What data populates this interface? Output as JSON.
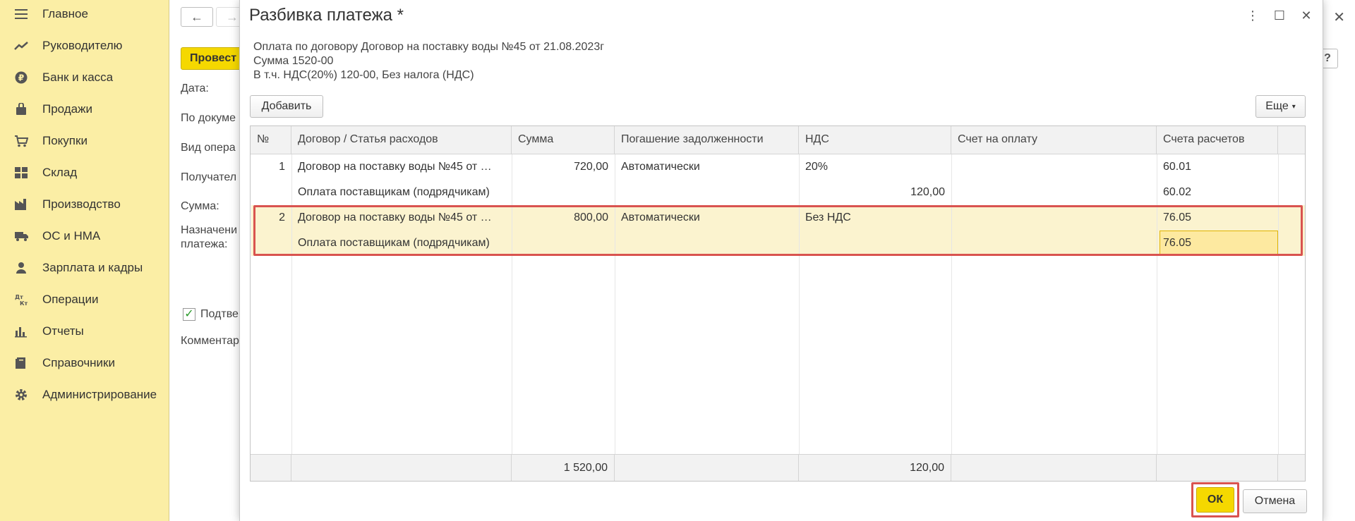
{
  "sidebar": {
    "items": [
      {
        "label": "Главное",
        "icon": "menu-icon"
      },
      {
        "label": "Руководителю",
        "icon": "trend-icon"
      },
      {
        "label": "Банк и касса",
        "icon": "ruble-icon"
      },
      {
        "label": "Продажи",
        "icon": "bag-icon"
      },
      {
        "label": "Покупки",
        "icon": "cart-icon"
      },
      {
        "label": "Склад",
        "icon": "warehouse-icon"
      },
      {
        "label": "Производство",
        "icon": "factory-icon"
      },
      {
        "label": "ОС и НМА",
        "icon": "truck-icon"
      },
      {
        "label": "Зарплата и кадры",
        "icon": "person-icon"
      },
      {
        "label": "Операции",
        "icon": "dtkt-icon"
      },
      {
        "label": "Отчеты",
        "icon": "bar-chart-icon"
      },
      {
        "label": "Справочники",
        "icon": "book-icon"
      },
      {
        "label": "Администрирование",
        "icon": "gear-icon"
      }
    ]
  },
  "background_form": {
    "post_label": "Провест",
    "labels": [
      "Дата:",
      "По докуме",
      "Вид опера",
      "Получател",
      "Сумма:",
      "Назначени",
      "платежа:",
      "Подтве",
      "Комментар"
    ],
    "help": "?"
  },
  "dialog": {
    "title": "Разбивка платежа *",
    "info": [
      "Оплата по договору Договор на поставку воды №45 от 21.08.2023г",
      "Сумма 1520-00",
      "В т.ч. НДС(20%) 120-00, Без налога (НДС)"
    ],
    "add_label": "Добавить",
    "more_label": "Еще",
    "ok_label": "ОК",
    "cancel_label": "Отмена"
  },
  "table": {
    "columns": [
      "№",
      "Договор / Статья расходов",
      "Сумма",
      "Погашение задолженности",
      "НДС",
      "Счет на оплату",
      "Счета расчетов"
    ],
    "rows": [
      {
        "num": "1",
        "contract": "Договор на поставку воды №45 от …",
        "item": "Оплата поставщикам (подрядчикам)",
        "sum": "720,00",
        "repay": "Автоматически",
        "vat": "20%",
        "vat_sum": "120,00",
        "invoice": "",
        "acc1": "60.01",
        "acc2": "60.02"
      },
      {
        "num": "2",
        "contract": "Договор на поставку воды №45 от …",
        "item": "Оплата поставщикам (подрядчикам)",
        "sum": "800,00",
        "repay": "Автоматически",
        "vat": "Без НДС",
        "vat_sum": "",
        "invoice": "",
        "acc1": "76.05",
        "acc2": "76.05"
      }
    ],
    "totals": {
      "sum": "1 520,00",
      "vat": "120,00"
    }
  },
  "colors": {
    "accent_yellow": "#f5d800",
    "sidebar_bg": "#fbeea5",
    "highlight_red": "#d9534f",
    "selected_row": "#fbf3cf"
  }
}
